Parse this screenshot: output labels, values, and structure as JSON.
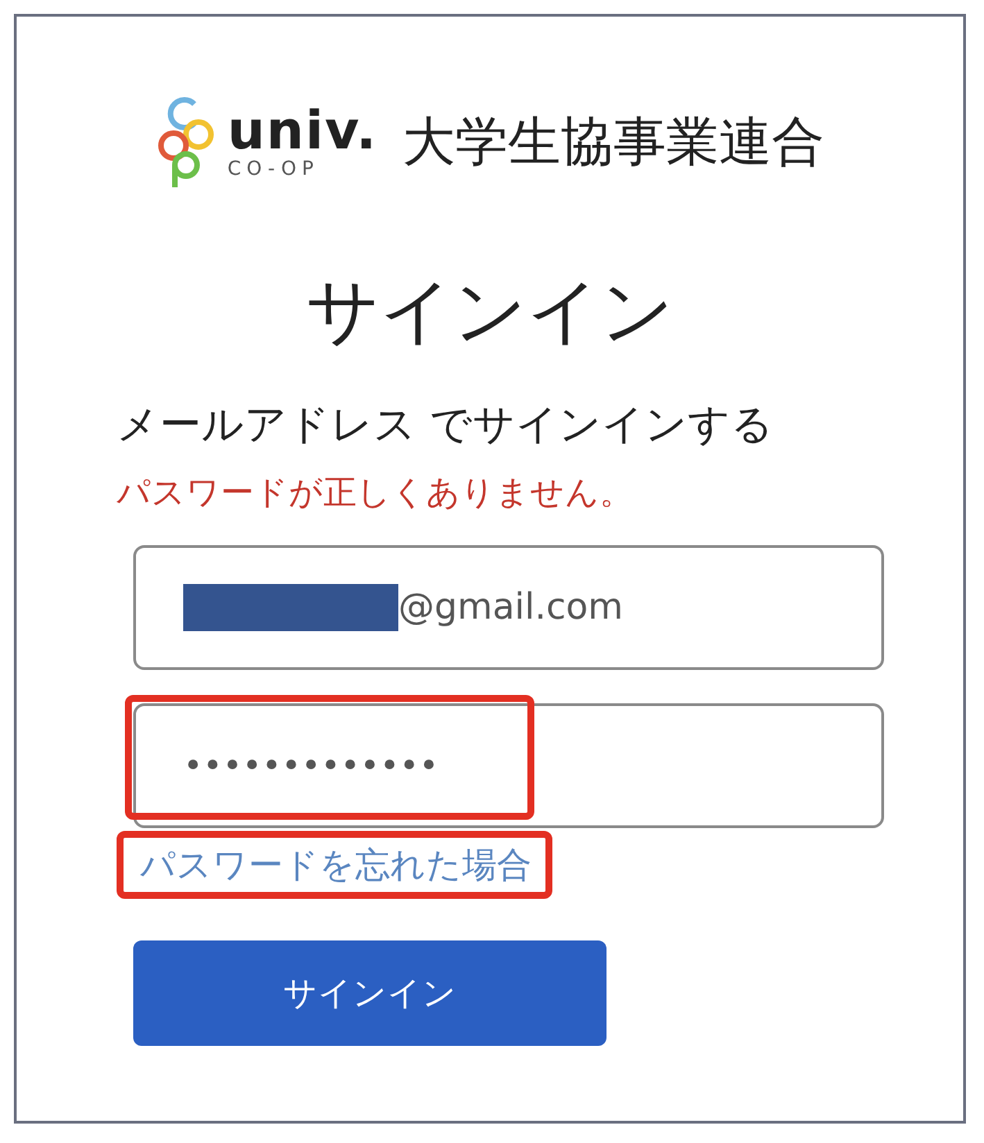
{
  "logo": {
    "wordmark": "univ.",
    "sub": "CO-OP",
    "name": "大学生協事業連合"
  },
  "title": "サインイン",
  "subtitle": "メールアドレス でサインインする",
  "error": "パスワードが正しくありません。",
  "fields": [
    {
      "kind": "email",
      "value": "@gmail.com",
      "redacted": true,
      "highlighted": false
    },
    {
      "kind": "password",
      "value": "•••••••••••••",
      "redacted": false,
      "highlighted": true
    }
  ],
  "forgot_link": {
    "label": "パスワードを忘れた場合",
    "highlighted": true
  },
  "button": "サインイン"
}
